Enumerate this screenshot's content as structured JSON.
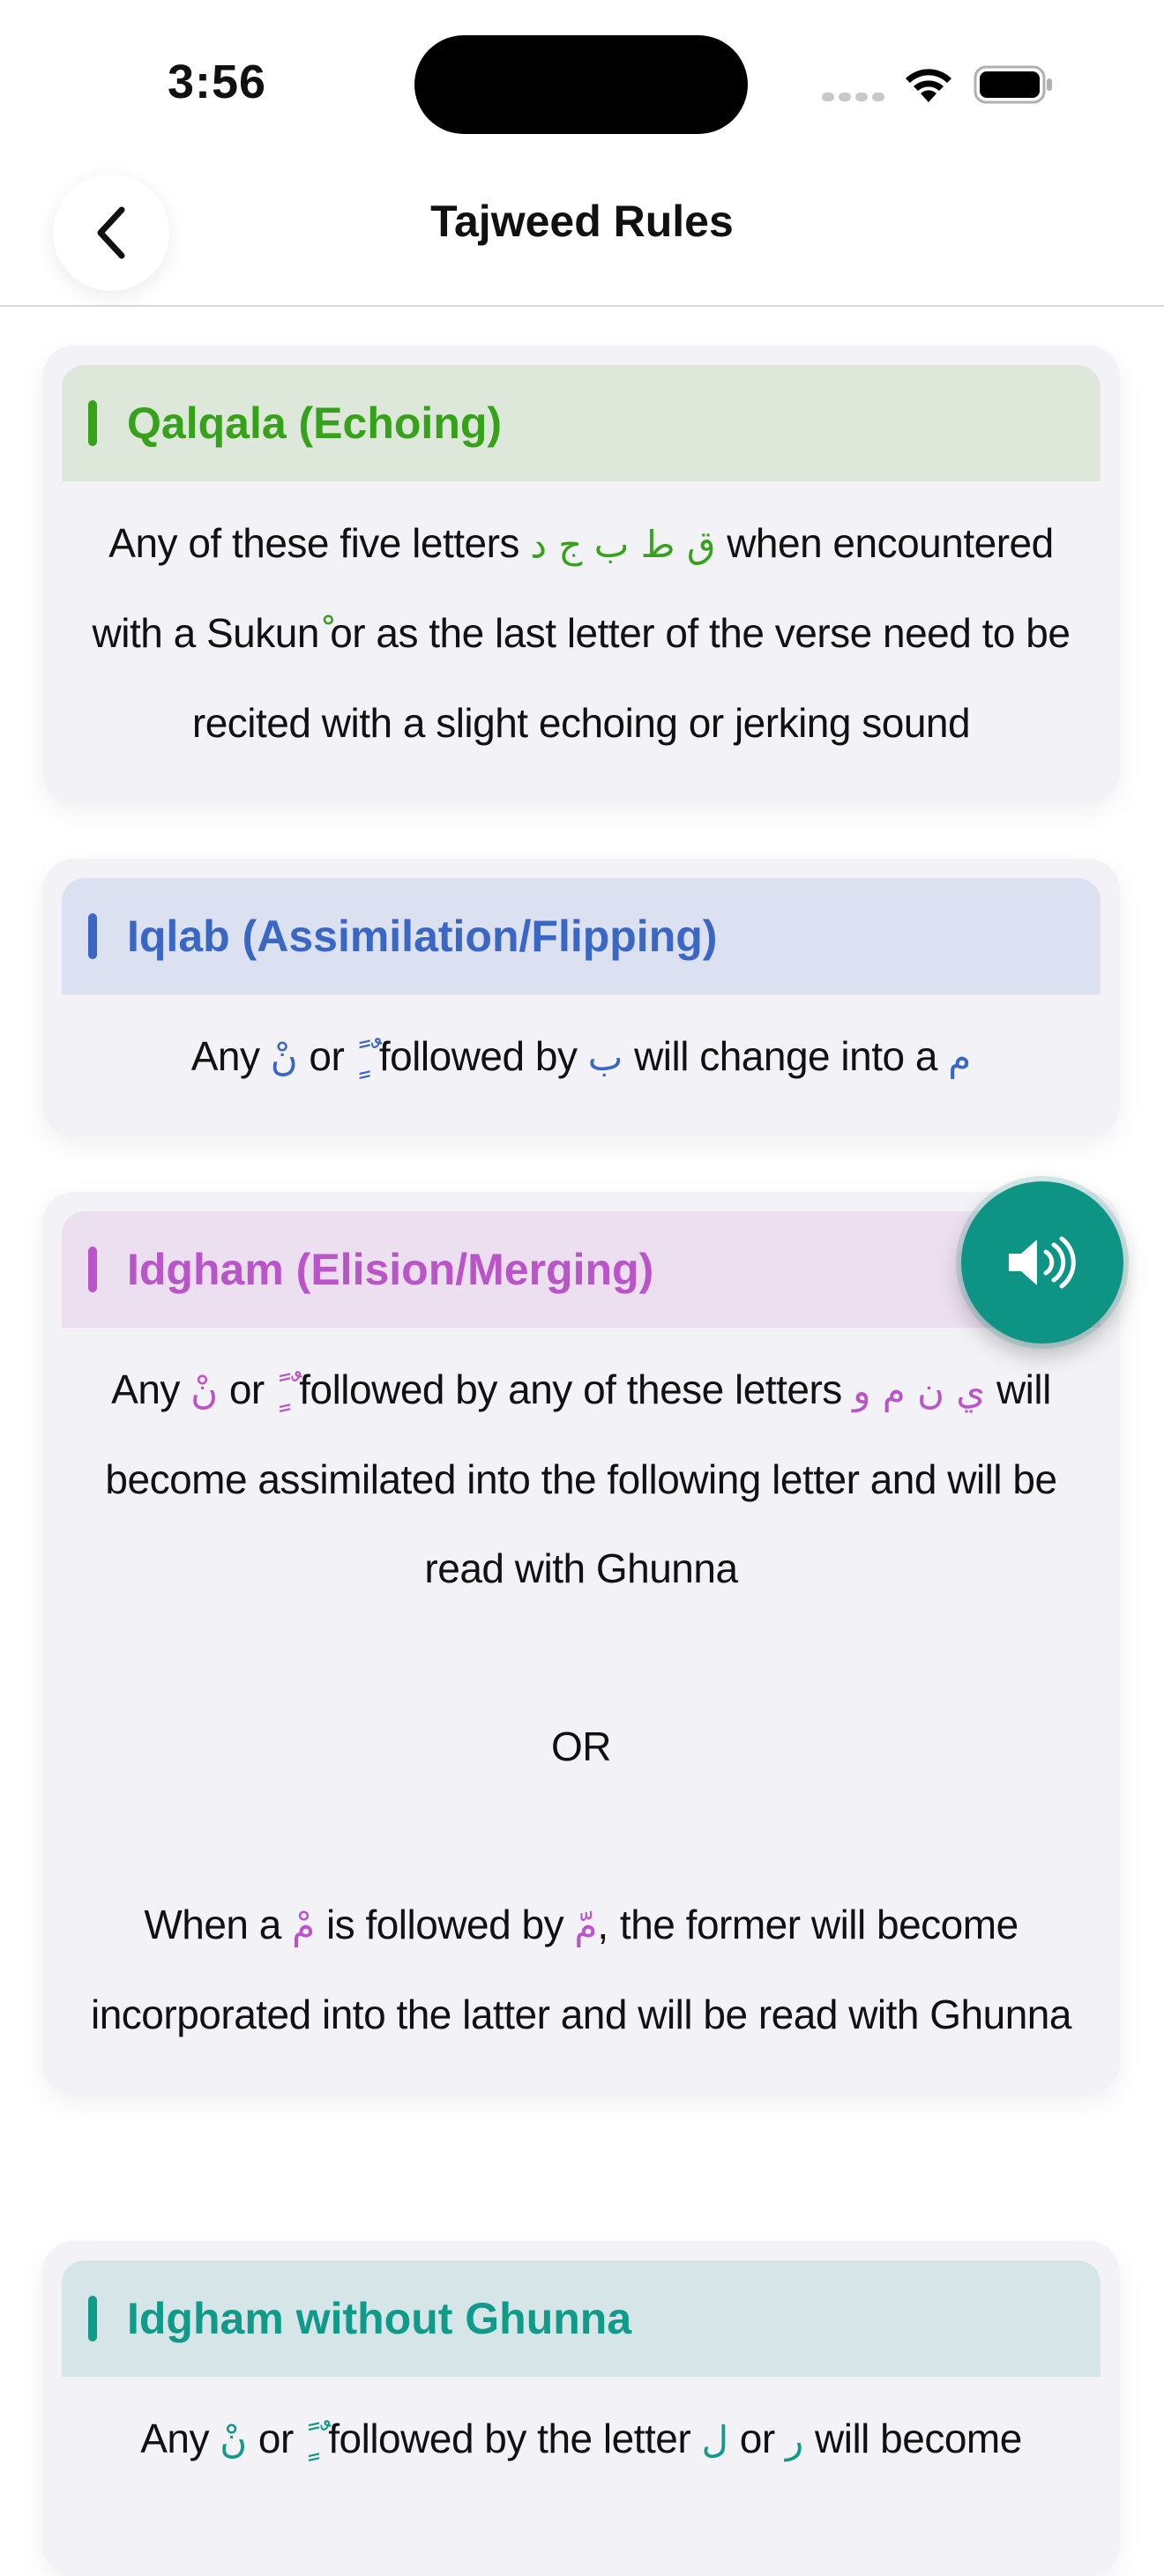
{
  "status": {
    "time": "3:56"
  },
  "nav": {
    "title": "Tajweed Rules",
    "back_icon": "chevron-left-icon"
  },
  "colors": {
    "qalqala": "#36a21a",
    "iqlab": "#3a66c4",
    "idgham": "#b954c9",
    "idgham_without_ghunna": "#0f9a8a",
    "audio_button": "#0e9484"
  },
  "cards": {
    "qalqala": {
      "title": "Qalqala (Echoing)",
      "t1": "Any of these five letters",
      "ar1": "ق ط ب ج د",
      "t2": "when encountered with a Sukun",
      "ar2": "ْ",
      "t3": "or as the last letter of the verse need to be recited with a slight echoing or jerking sound"
    },
    "iqlab": {
      "title": "Iqlab (Assimilation/Flipping)",
      "t1": "Any",
      "ar1": "نْ",
      "t2": "or",
      "ar2": "ً ٍ ٌ",
      "t3": "followed by",
      "ar3": "ب",
      "t4": "will change into a",
      "ar4": "م"
    },
    "idgham": {
      "title": "Idgham (Elision/Merging)",
      "t1": "Any",
      "ar1": "نْ",
      "t2": "or",
      "ar2": "ً ٍ ٌ",
      "t3": "followed by any of these letters",
      "ar3": "ي ن م و",
      "t4": "will become assimilated into the following letter and will be read with Ghunna",
      "or": "OR",
      "t5": "When a",
      "ar5": "مْ",
      "t6": "is followed by",
      "ar6": "مّ",
      "t7": ", the former will become incorporated into the latter and will be read with Ghunna"
    },
    "idgham_without_ghunna": {
      "title": "Idgham without Ghunna",
      "t1": "Any",
      "ar1": "نْ",
      "t2": "or",
      "ar2": "ً ٍ ٌ",
      "t3": "followed by the letter",
      "ar3": "ل",
      "t4": "or",
      "ar4": "ر",
      "t5": "will become"
    }
  },
  "audio_button": {
    "icon": "speaker-icon"
  }
}
